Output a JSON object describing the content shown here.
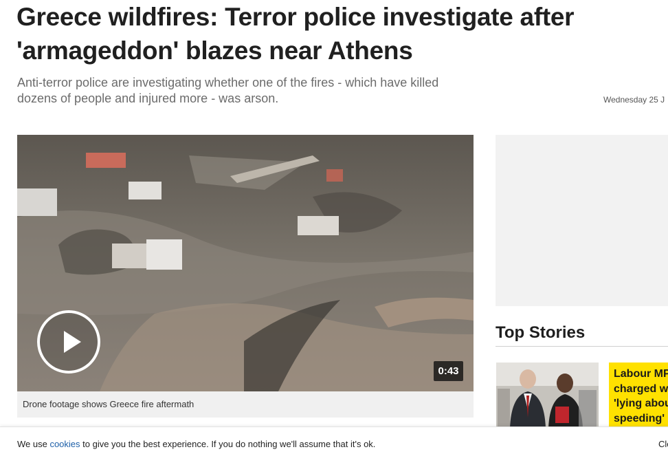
{
  "article": {
    "headline": "Greece wildfires: Terror police investigate after 'armageddon' blazes near Athens",
    "standfirst": "Anti-terror police are investigating whether one of the fires - which have killed dozens of people and injured more - was arson.",
    "meta_top": "",
    "date": "Wednesday 25 J"
  },
  "video": {
    "duration": "0:43",
    "caption": "Drone footage shows Greece fire aftermath"
  },
  "sidebar": {
    "top_stories_title": "Top Stories",
    "story_headline": "Labour MP charged w 'lying abou speeding'"
  },
  "cookie_bar": {
    "text_before": "We use ",
    "link": "cookies",
    "text_after": " to give you the best experience. If you do nothing we'll assume that it's ok.",
    "close_label": "Clo"
  },
  "icons": {
    "play": "play-icon"
  },
  "colors": {
    "story_card_bg": "#ffe100",
    "cookie_link": "#1d5fa8",
    "standfirst": "#6b6b6b"
  }
}
